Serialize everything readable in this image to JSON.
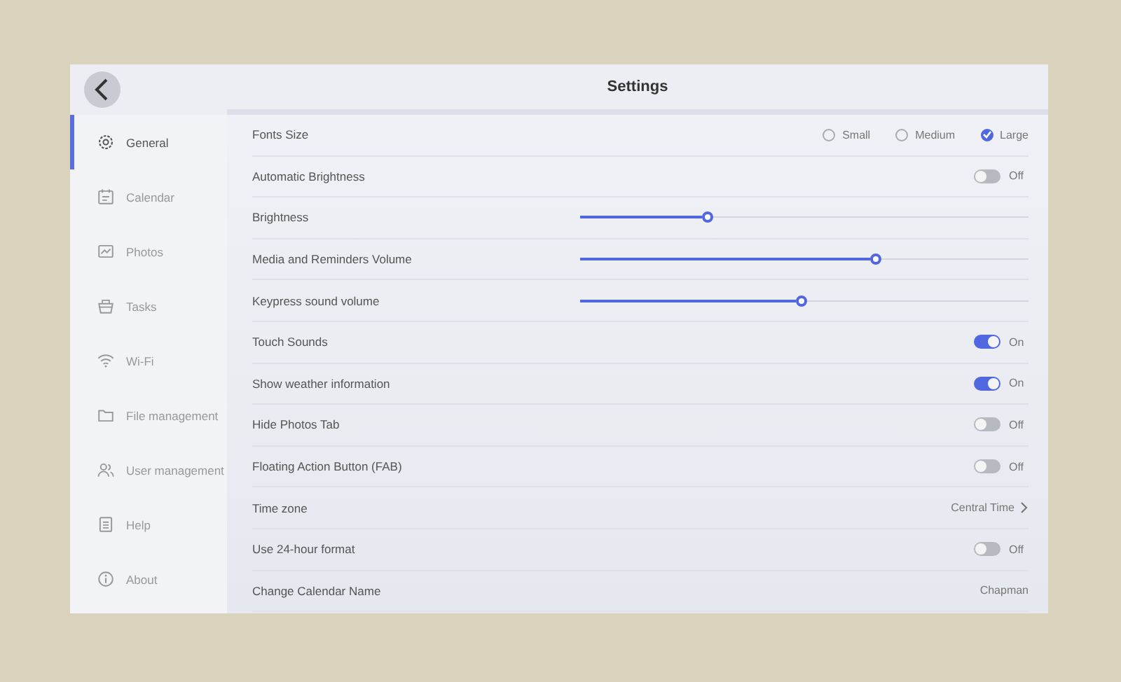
{
  "header": {
    "title": "Settings"
  },
  "sidebar": {
    "items": [
      {
        "label": "General",
        "selected": true
      },
      {
        "label": "Calendar",
        "selected": false
      },
      {
        "label": "Photos",
        "selected": false
      },
      {
        "label": "Tasks",
        "selected": false
      },
      {
        "label": "Wi-Fi",
        "selected": false
      },
      {
        "label": "File management",
        "selected": false
      },
      {
        "label": "User management",
        "selected": false
      },
      {
        "label": "Help",
        "selected": false
      },
      {
        "label": "About",
        "selected": false
      }
    ]
  },
  "settings": [
    {
      "kind": "radio",
      "label": "Fonts Size",
      "options": [
        {
          "label": "Small",
          "selected": false
        },
        {
          "label": "Medium",
          "selected": false
        },
        {
          "label": "Large",
          "selected": true
        }
      ]
    },
    {
      "kind": "toggle",
      "label": "Automatic Brightness",
      "on": false,
      "value": "Off"
    },
    {
      "kind": "slider",
      "label": "Brightness",
      "level": 0.285
    },
    {
      "kind": "slider",
      "label": "Media and Reminders Volume",
      "level": 0.66
    },
    {
      "kind": "slider",
      "label": "Keypress sound volume",
      "level": 0.495
    },
    {
      "kind": "toggle",
      "label": "Touch Sounds",
      "on": true,
      "value": "On"
    },
    {
      "kind": "toggle",
      "label": "Show weather information",
      "on": true,
      "value": "On"
    },
    {
      "kind": "toggle",
      "label": "Hide Photos Tab",
      "on": false,
      "value": "Off"
    },
    {
      "kind": "toggle",
      "label": "Floating Action Button (FAB)",
      "on": false,
      "value": "Off"
    },
    {
      "kind": "link",
      "label": "Time zone",
      "value": "Central Time"
    },
    {
      "kind": "toggle",
      "label": "Use 24-hour format",
      "on": false,
      "value": "Off"
    },
    {
      "kind": "value",
      "label": "Change Calendar Name",
      "value": "Chapman"
    }
  ]
}
